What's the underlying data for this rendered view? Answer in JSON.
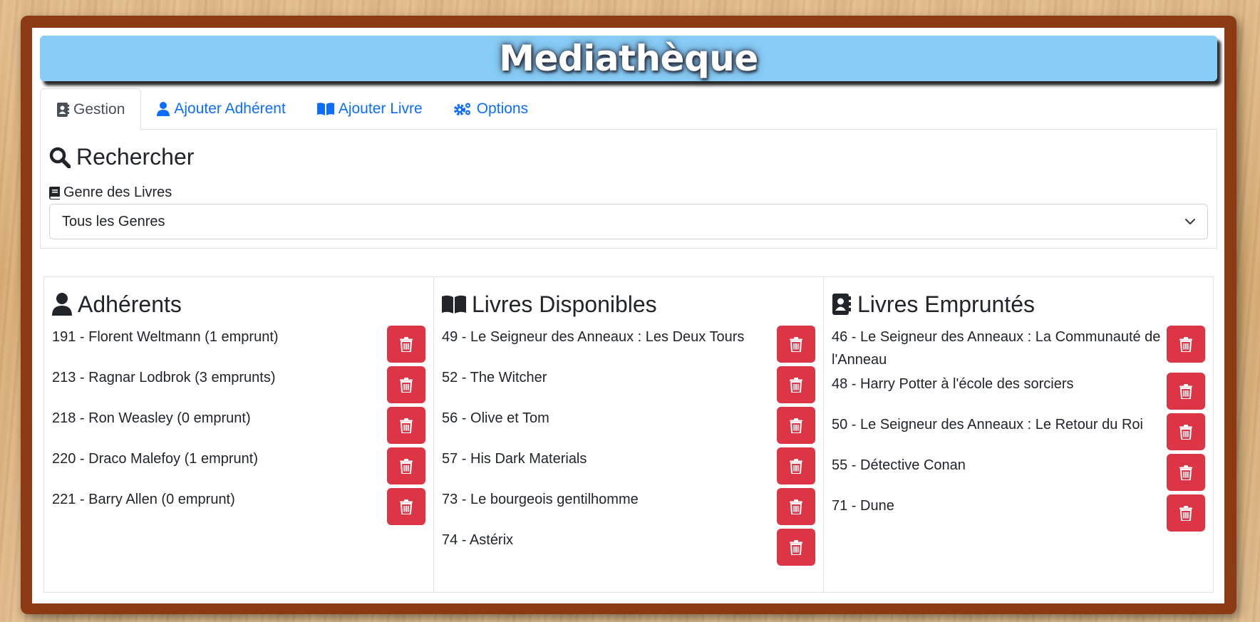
{
  "app": {
    "title": "Mediathèque"
  },
  "tabs": [
    {
      "label": "Gestion",
      "icon": "address-book-icon"
    },
    {
      "label": "Ajouter Adhérent",
      "icon": "user-icon"
    },
    {
      "label": "Ajouter Livre",
      "icon": "open-book-icon"
    },
    {
      "label": "Options",
      "icon": "gears-icon"
    }
  ],
  "search": {
    "title": "Rechercher",
    "genre_label": "Genre des Livres",
    "genre_value": "Tous les Genres"
  },
  "members": {
    "title": "Adhérents",
    "items": [
      "191 - Florent Weltmann (1 emprunt)",
      "213 - Ragnar Lodbrok (3 emprunts)",
      "218 - Ron Weasley (0 emprunt)",
      "220 - Draco Malefoy (1 emprunt)",
      "221 - Barry Allen (0 emprunt)"
    ]
  },
  "available": {
    "title": "Livres Disponibles",
    "items": [
      "49 - Le Seigneur des Anneaux : Les Deux Tours",
      "52 - The Witcher",
      "56 - Olive et Tom",
      "57 - His Dark Materials",
      "73 - Le bourgeois gentilhomme",
      "74 - Astérix"
    ]
  },
  "borrowed": {
    "title": "Livres Empruntés",
    "items": [
      "46 - Le Seigneur des Anneaux : La Communauté de l'Anneau",
      "48 - Harry Potter à l'école des sorciers",
      "50 - Le Seigneur des Anneaux : Le Retour du Roi",
      "55 - Détective Conan",
      "71 - Dune"
    ]
  },
  "colors": {
    "header_bg": "#87cdf7",
    "frame": "#8b3a14",
    "delete_button": "#dc3545",
    "link": "#0d6efd"
  }
}
